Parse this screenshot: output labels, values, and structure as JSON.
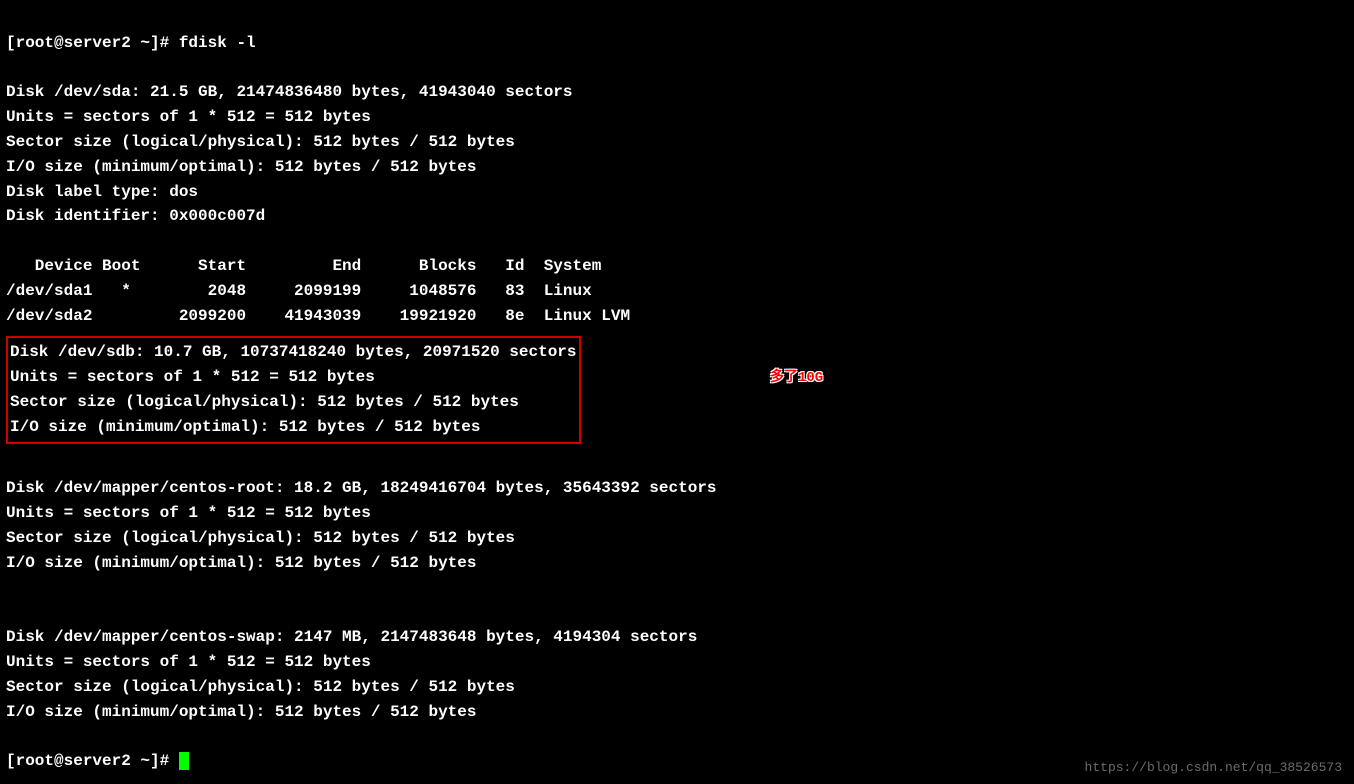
{
  "prompt1": "[root@server2 ~]# fdisk -l",
  "disk_sda": {
    "header": "Disk /dev/sda: 21.5 GB, 21474836480 bytes, 41943040 sectors",
    "units": "Units = sectors of 1 * 512 = 512 bytes",
    "sector_size": "Sector size (logical/physical): 512 bytes / 512 bytes",
    "io_size": "I/O size (minimum/optimal): 512 bytes / 512 bytes",
    "label_type": "Disk label type: dos",
    "identifier": "Disk identifier: 0x000c007d"
  },
  "partition_table": {
    "header": "   Device Boot      Start         End      Blocks   Id  System",
    "row1": "/dev/sda1   *        2048     2099199     1048576   83  Linux",
    "row2": "/dev/sda2         2099200    41943039    19921920   8e  Linux LVM"
  },
  "disk_sdb": {
    "header": "Disk /dev/sdb: 10.7 GB, 10737418240 bytes, 20971520 sectors",
    "units": "Units = sectors of 1 * 512 = 512 bytes",
    "sector_size": "Sector size (logical/physical): 512 bytes / 512 bytes",
    "io_size": "I/O size (minimum/optimal): 512 bytes / 512 bytes"
  },
  "annotation_text": "多了10G",
  "disk_centos_root": {
    "header": "Disk /dev/mapper/centos-root: 18.2 GB, 18249416704 bytes, 35643392 sectors",
    "units": "Units = sectors of 1 * 512 = 512 bytes",
    "sector_size": "Sector size (logical/physical): 512 bytes / 512 bytes",
    "io_size": "I/O size (minimum/optimal): 512 bytes / 512 bytes"
  },
  "disk_centos_swap": {
    "header": "Disk /dev/mapper/centos-swap: 2147 MB, 2147483648 bytes, 4194304 sectors",
    "units": "Units = sectors of 1 * 512 = 512 bytes",
    "sector_size": "Sector size (logical/physical): 512 bytes / 512 bytes",
    "io_size": "I/O size (minimum/optimal): 512 bytes / 512 bytes"
  },
  "prompt2": "[root@server2 ~]# ",
  "watermark": "https://blog.csdn.net/qq_38526573"
}
